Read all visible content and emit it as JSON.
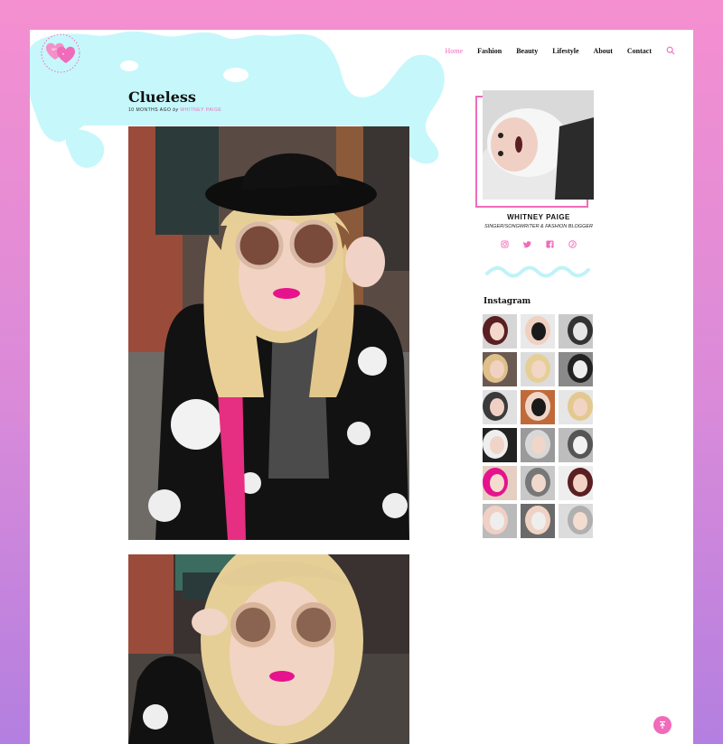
{
  "site": {
    "logo_icon": "hearts-logo-icon"
  },
  "nav": {
    "items": [
      {
        "label": "Home",
        "active": true
      },
      {
        "label": "Fashion",
        "active": false
      },
      {
        "label": "Beauty",
        "active": false
      },
      {
        "label": "Lifestyle",
        "active": false
      },
      {
        "label": "About",
        "active": false
      },
      {
        "label": "Contact",
        "active": false
      }
    ],
    "search_icon": "search-icon"
  },
  "post": {
    "title": "Clueless",
    "meta_time": "10 MONTHS AGO",
    "meta_by": "by",
    "meta_author": "WHITNEY PAIGE"
  },
  "sidebar": {
    "profile_name": "WHITNEY PAIGE",
    "profile_tagline": "SINGER/SONGWRITER & FASHION BLOGGER",
    "social_icons": [
      "instagram-icon",
      "twitter-icon",
      "facebook-icon",
      "pinterest-icon"
    ],
    "instagram_heading": "Instagram",
    "instagram_count": 18
  },
  "colors": {
    "accent": "#f06bb9",
    "blob": "#c6f7fb",
    "frame": "#f06bb9"
  },
  "back_to_top_icon": "arrow-up-icon"
}
